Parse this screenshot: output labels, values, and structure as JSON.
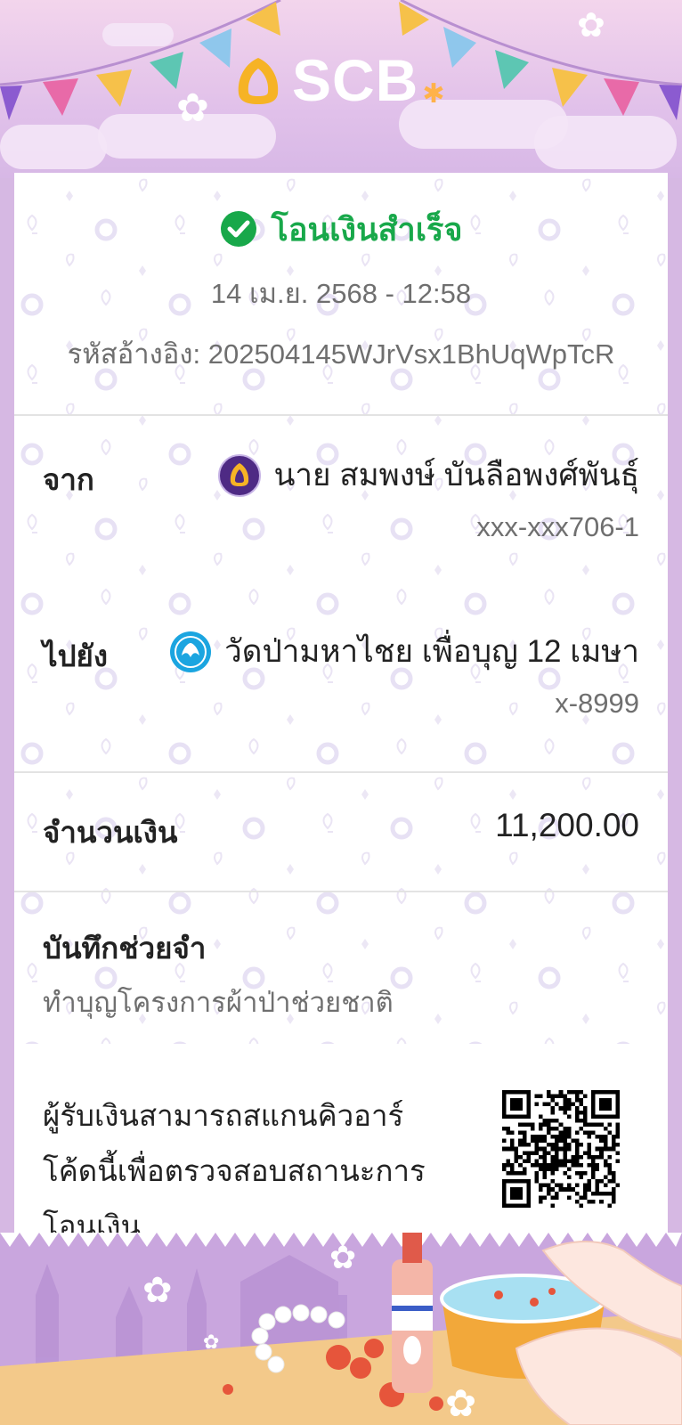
{
  "header": {
    "logo_text": "SCB"
  },
  "status": {
    "title": "โอนเงินสำเร็จ",
    "datetime": "14 เม.ย. 2568 - 12:58",
    "ref_label": "รหัสอ้างอิง:",
    "ref_value": "202504145WJrVsx1BhUqWpTcR"
  },
  "from": {
    "label": "จาก",
    "name": "นาย สมพงษ์ บันลือพงศ์พันธุ์",
    "account": "xxx-xxx706-1"
  },
  "to": {
    "label": "ไปยัง",
    "name": "วัดป่ามหาไชย เพื่อบุญ 12 เมษา",
    "account": "x-8999"
  },
  "amount": {
    "label": "จำนวนเงิน",
    "value": "11,200.00"
  },
  "memo": {
    "label": "บันทึกช่วยจำ",
    "text": "ทำบุญโครงการผ้าป่าช่วยชาติ"
  },
  "qr": {
    "line1": "ผู้รับเงินสามารถสแกนคิวอาร์",
    "line2": "โค้ดนี้เพื่อตรวจสอบสถานะการ",
    "line3": "โอนเงิน"
  },
  "colors": {
    "success_green": "#18a84a",
    "scb_purple": "#4e2a84",
    "background_lilac": "#d6b8e3"
  }
}
